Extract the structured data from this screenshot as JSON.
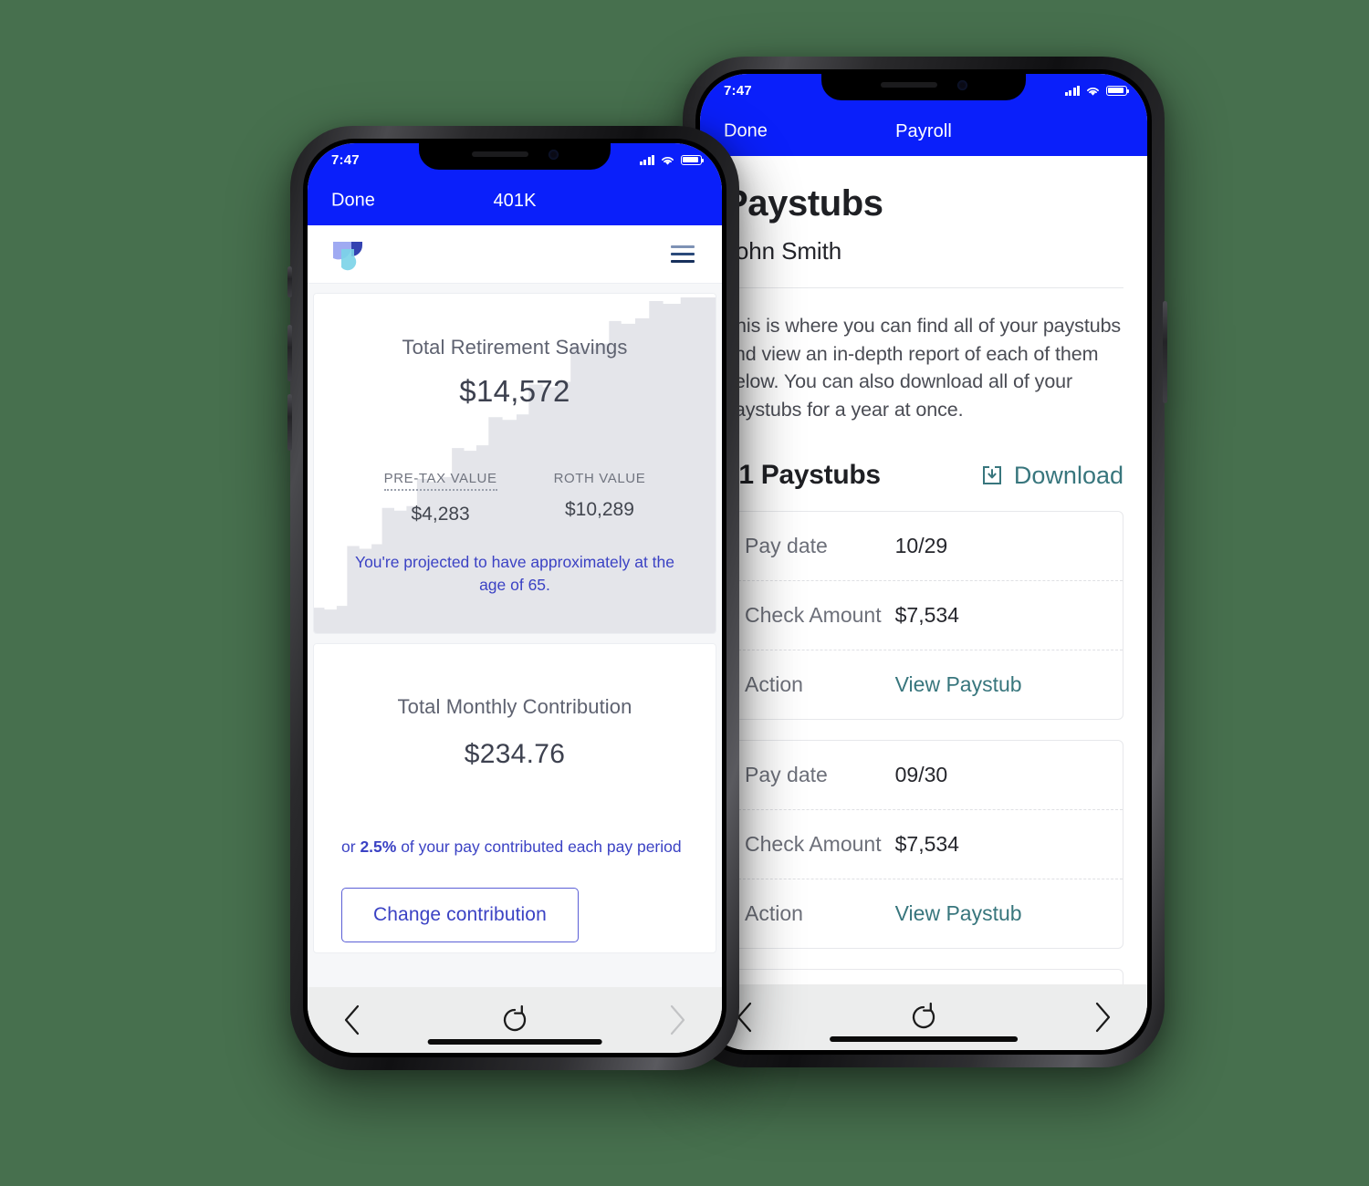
{
  "background_color": "#47704e",
  "accent": {
    "status_blue": "#0a1ffa",
    "indigo": "#3b42c4",
    "teal": "#38767d",
    "chart_gray": "#e4e5ea"
  },
  "back_phone": {
    "status": {
      "time": "7:47",
      "signal_icon": "cellular-bars-icon",
      "wifi_icon": "wifi-icon",
      "battery_icon": "battery-icon"
    },
    "navbar": {
      "done_label": "Done",
      "title": "Payroll"
    },
    "page": {
      "title": "Paystubs",
      "subtitle": "John Smith",
      "paragraph": "This is where you can find all of your paystubs and view an in-depth report of each of them below. You can also download all of your paystubs for a year at once.",
      "count_label": "21 Paystubs",
      "download_label": "Download",
      "download_icon": "download-tray-icon",
      "row_labels": {
        "pay_date": "Pay date",
        "check_amount": "Check Amount",
        "action": "Action"
      },
      "paystubs": [
        {
          "pay_date": "10/29",
          "check_amount": "$7,534",
          "action": "View Paystub"
        },
        {
          "pay_date": "09/30",
          "check_amount": "$7,534",
          "action": "View Paystub"
        }
      ]
    },
    "toolbar": {
      "back_icon": "chevron-left-icon",
      "reload_icon": "reload-icon",
      "forward_icon": "chevron-right-icon"
    }
  },
  "front_phone": {
    "status": {
      "time": "7:47",
      "signal_icon": "cellular-bars-icon",
      "wifi_icon": "wifi-icon",
      "battery_icon": "battery-icon"
    },
    "navbar": {
      "done_label": "Done",
      "title": "401K"
    },
    "app_header": {
      "logo_icon": "brand-logo-icon",
      "menu_icon": "hamburger-menu-icon"
    },
    "savings_card": {
      "label": "Total Retirement Savings",
      "value": "$14,572",
      "pretax_label": "PRE-TAX VALUE",
      "pretax_value": "$4,283",
      "roth_label": "ROTH VALUE",
      "roth_value": "$10,289",
      "projection": "You're projected to have approximately at the age of 65."
    },
    "contribution_card": {
      "label": "Total Monthly Contribution",
      "value": "$234.76",
      "rate_prefix": "or ",
      "rate_percent": "2.5%",
      "rate_suffix": " of your pay contributed each pay period",
      "change_button": "Change contribution"
    },
    "toolbar": {
      "back_icon": "chevron-left-icon",
      "reload_icon": "reload-icon",
      "forward_icon": "chevron-right-icon"
    }
  },
  "chart_data": {
    "type": "area",
    "title": "Total Retirement Savings growth",
    "style": "step-area",
    "fill_color": "#e4e5ea",
    "xlabel": "",
    "ylabel": "",
    "x": [
      0,
      1,
      2,
      3,
      4,
      5,
      6,
      7,
      8,
      9,
      10,
      11,
      12,
      13,
      14,
      15,
      16,
      17,
      18,
      19,
      20,
      21,
      22,
      23
    ],
    "values": [
      1050,
      1020,
      1060,
      2600,
      2560,
      2610,
      3900,
      3870,
      3930,
      5150,
      5100,
      5160,
      7400,
      7350,
      7420,
      9000,
      8960,
      9050,
      11200,
      11150,
      12600,
      12550,
      14572,
      14500
    ],
    "ylim": [
      0,
      15600
    ]
  }
}
